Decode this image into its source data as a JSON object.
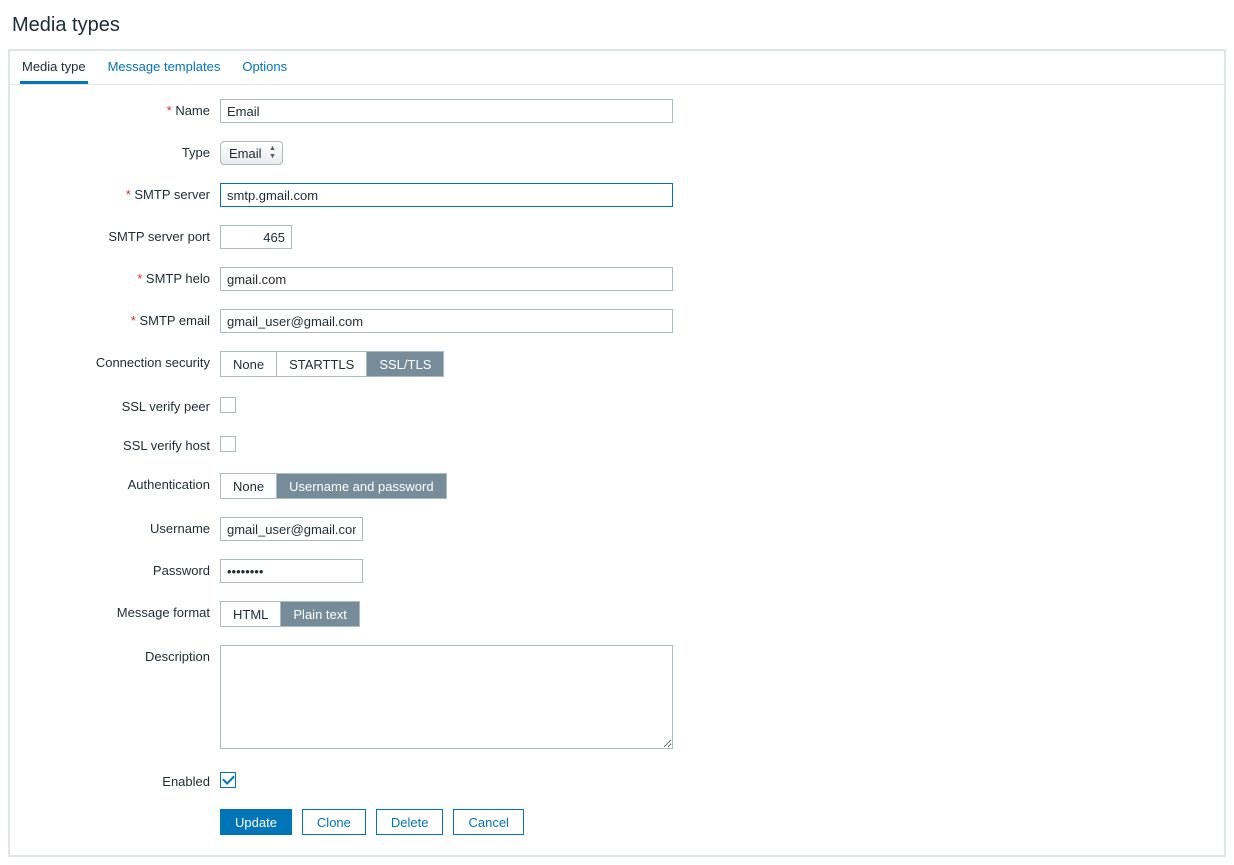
{
  "page": {
    "title": "Media types"
  },
  "tabs": {
    "media_type": "Media type",
    "message_templates": "Message templates",
    "options": "Options"
  },
  "labels": {
    "name": "Name",
    "type": "Type",
    "smtp_server": "SMTP server",
    "smtp_port": "SMTP server port",
    "smtp_helo": "SMTP helo",
    "smtp_email": "SMTP email",
    "conn_security": "Connection security",
    "ssl_verify_peer": "SSL verify peer",
    "ssl_verify_host": "SSL verify host",
    "authentication": "Authentication",
    "username": "Username",
    "password": "Password",
    "message_format": "Message format",
    "description": "Description",
    "enabled": "Enabled"
  },
  "values": {
    "name": "Email",
    "type": "Email",
    "smtp_server": "smtp.gmail.com",
    "smtp_port": "465",
    "smtp_helo": "gmail.com",
    "smtp_email": "gmail_user@gmail.com",
    "username": "gmail_user@gmail.com",
    "password": "••••••••",
    "description": "",
    "enabled": true,
    "ssl_verify_peer": false,
    "ssl_verify_host": false
  },
  "options": {
    "conn_security": {
      "none": "None",
      "starttls": "STARTTLS",
      "ssltls": "SSL/TLS"
    },
    "authentication": {
      "none": "None",
      "userpass": "Username and password"
    },
    "message_format": {
      "html": "HTML",
      "plain": "Plain text"
    }
  },
  "buttons": {
    "update": "Update",
    "clone": "Clone",
    "delete": "Delete",
    "cancel": "Cancel"
  }
}
